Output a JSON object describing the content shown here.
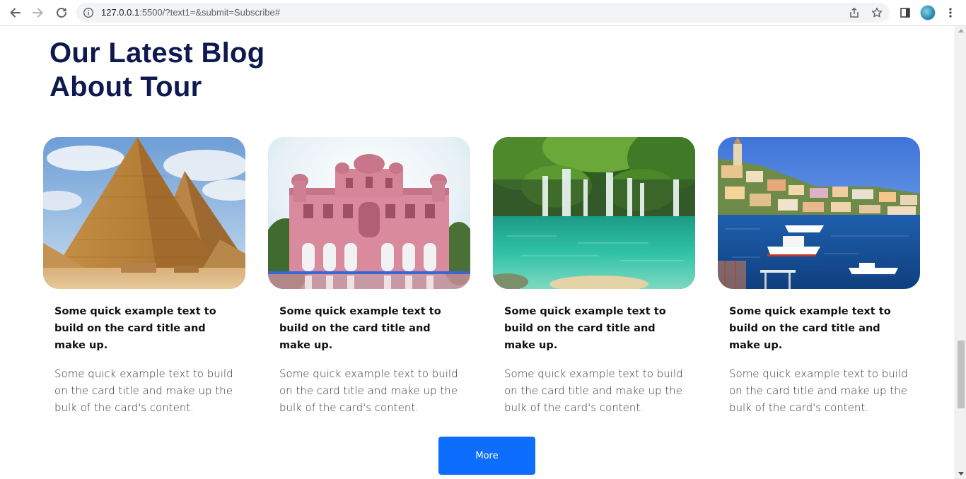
{
  "browser": {
    "url_host": "127.0.0.1",
    "url_rest": ":5500/?text1=&submit=Subscribe#",
    "icons": [
      "back-arrow-icon",
      "forward-arrow-icon",
      "reload-icon",
      "info-icon",
      "share-icon",
      "star-icon",
      "side-panel-icon",
      "profile-avatar",
      "menu-dots-icon"
    ]
  },
  "page": {
    "heading_line1": "Our Latest Blog",
    "heading_line2": "About Tour",
    "heading_color": "#0e1a4f",
    "cards": [
      {
        "image": "pyramids-image",
        "title": "Some quick example text to build on the card title and make up.",
        "text": "Some quick example text to build on the card title and make up the bulk of the card's content."
      },
      {
        "image": "pink-palace-image",
        "title": "Some quick example text to build on the card title and make up.",
        "text": "Some quick example text to build on the card title and make up the bulk of the card's content."
      },
      {
        "image": "waterfall-lagoon-image",
        "title": "Some quick example text to build on the card title and make up.",
        "text": "Some quick example text to build on the card title and make up the bulk of the card's content."
      },
      {
        "image": "harbor-town-image",
        "title": "Some quick example text to build on the card title and make up.",
        "text": "Some quick example text to build on the card title and make up the bulk of the card's content."
      }
    ],
    "more_button": "More",
    "button_color": "#0d6efd"
  }
}
